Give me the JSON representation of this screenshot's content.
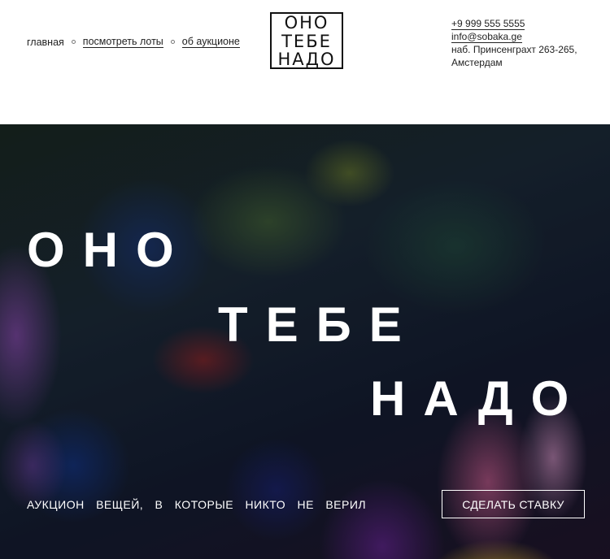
{
  "nav": {
    "items": [
      {
        "label": "главная"
      },
      {
        "label": "посмотреть лоты"
      },
      {
        "label": "об аукционе"
      }
    ]
  },
  "logo": {
    "lines": [
      "ОНО",
      "ТЕБЕ",
      "НАДО"
    ]
  },
  "contacts": {
    "phone": "+9 999 555 5555",
    "email": "info@sobaka.ge",
    "address": "наб. Принсенграхт 263-265, Амстердам"
  },
  "hero": {
    "words": [
      "ОНО",
      "ТЕБЕ",
      "НАДО"
    ],
    "tagline": "АУКЦИОН ВЕЩЕЙ, В КОТОРЫЕ НИКТО НЕ ВЕРИЛ",
    "button_label": "СДЕЛАТЬ СТАВКУ"
  }
}
